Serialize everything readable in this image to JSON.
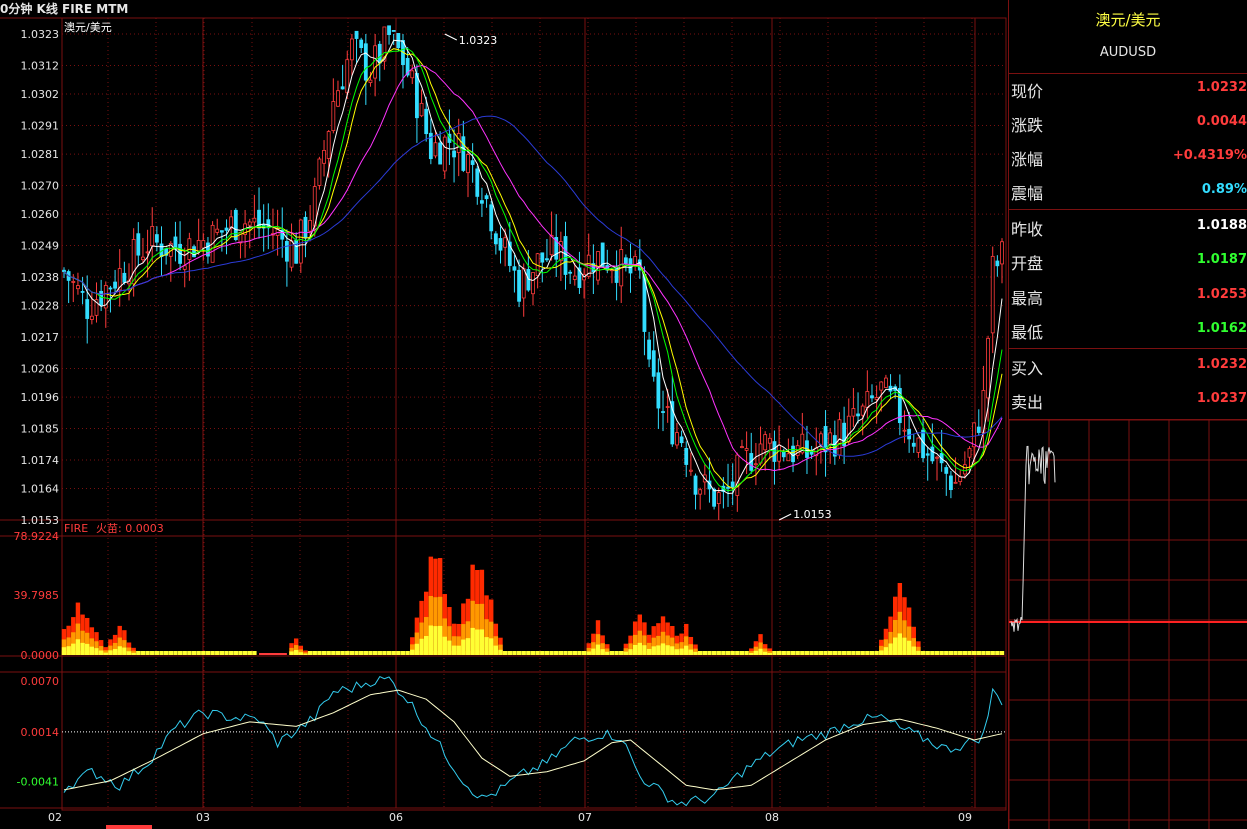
{
  "header": {
    "title": "0分钟 K线 FIRE MTM"
  },
  "colors": {
    "bg": "#000000",
    "grid": "#7a1010",
    "up": "#ff3c3c",
    "down": "#33ddff",
    "ma5": "#ffffff",
    "ma10": "#ffff00",
    "ma20": "#ff33ff",
    "ma30": "#00ff00",
    "ma60": "#2b3bd6",
    "fire_top": "#ff2a00",
    "fire_mid": "#ff9900",
    "fire_base": "#ffff33",
    "mtm": "#33ccee",
    "mtm_ma": "#ffffcc"
  },
  "chart_data": [
    {
      "type": "candlestick",
      "title": "澳元/美元",
      "y_ticks": [
        "1.0323",
        "1.0312",
        "1.0302",
        "1.0291",
        "1.0281",
        "1.0270",
        "1.0260",
        "1.0249",
        "1.0238",
        "1.0228",
        "1.0217",
        "1.0206",
        "1.0196",
        "1.0185",
        "1.0174",
        "1.0164",
        "1.0153"
      ],
      "ylim": [
        1.0153,
        1.0323
      ],
      "x_ticks": [
        "02",
        "03",
        "06",
        "07",
        "08",
        "09"
      ],
      "annotations": {
        "high_label": "1.0323",
        "low_label": "1.0153"
      },
      "close_path": [
        [
          0,
          1.024
        ],
        [
          5,
          1.0228
        ],
        [
          10,
          1.0236
        ],
        [
          18,
          1.025
        ],
        [
          25,
          1.0248
        ],
        [
          32,
          1.0252
        ],
        [
          38,
          1.0258
        ],
        [
          45,
          1.0254
        ],
        [
          50,
          1.0247
        ],
        [
          54,
          1.0265
        ],
        [
          58,
          1.03
        ],
        [
          62,
          1.0318
        ],
        [
          66,
          1.031
        ],
        [
          70,
          1.0322
        ],
        [
          73,
          1.0314
        ],
        [
          76,
          1.03
        ],
        [
          79,
          1.0283
        ],
        [
          83,
          1.0286
        ],
        [
          86,
          1.0282
        ],
        [
          90,
          1.027
        ],
        [
          94,
          1.025
        ],
        [
          98,
          1.0235
        ],
        [
          102,
          1.0243
        ],
        [
          106,
          1.0247
        ],
        [
          110,
          1.024
        ],
        [
          114,
          1.0245
        ],
        [
          118,
          1.0244
        ],
        [
          121,
          1.024
        ],
        [
          124,
          1.0238
        ],
        [
          126,
          1.0203
        ],
        [
          129,
          1.019
        ],
        [
          133,
          1.0182
        ],
        [
          136,
          1.0168
        ],
        [
          139,
          1.0162
        ],
        [
          142,
          1.016
        ],
        [
          146,
          1.0172
        ],
        [
          150,
          1.018
        ],
        [
          155,
          1.0178
        ],
        [
          160,
          1.0176
        ],
        [
          164,
          1.018
        ],
        [
          168,
          1.0184
        ],
        [
          172,
          1.019
        ],
        [
          176,
          1.0198
        ],
        [
          180,
          1.019
        ],
        [
          184,
          1.018
        ],
        [
          188,
          1.0172
        ],
        [
          192,
          1.0166
        ],
        [
          195,
          1.0176
        ],
        [
          198,
          1.0195
        ],
        [
          200,
          1.024
        ],
        [
          202,
          1.0245
        ]
      ],
      "candle_count": 203
    },
    {
      "type": "area",
      "title": "FIRE",
      "label": "火苗: 0.0003",
      "y_ticks": [
        "78.9224",
        "39.7985",
        "0.0000"
      ],
      "ylim": [
        0,
        78.9224
      ],
      "spikes": [
        {
          "at": 3,
          "peak": 36,
          "width": 6
        },
        {
          "at": 12,
          "peak": 22,
          "width": 3
        },
        {
          "at": 50,
          "peak": 12,
          "width": 2
        },
        {
          "at": 80,
          "peak": 79,
          "width": 5
        },
        {
          "at": 89,
          "peak": 74,
          "width": 5
        },
        {
          "at": 115,
          "peak": 24,
          "width": 2
        },
        {
          "at": 124,
          "peak": 30,
          "width": 3
        },
        {
          "at": 129,
          "peak": 34,
          "width": 4
        },
        {
          "at": 134,
          "peak": 22,
          "width": 2
        },
        {
          "at": 150,
          "peak": 14,
          "width": 2
        },
        {
          "at": 180,
          "peak": 54,
          "width": 4
        }
      ],
      "gap": [
        42,
        48
      ]
    },
    {
      "type": "line",
      "title": "MTM",
      "y_ticks": [
        "0.0070",
        "0.0014",
        "-0.0041"
      ],
      "ylim": [
        -0.007,
        0.008
      ],
      "series": [
        {
          "name": "MTM",
          "points": [
            [
              0,
              -0.0048
            ],
            [
              6,
              -0.003
            ],
            [
              12,
              -0.0045
            ],
            [
              18,
              -0.002
            ],
            [
              24,
              0.0018
            ],
            [
              30,
              0.0035
            ],
            [
              36,
              0.003
            ],
            [
              42,
              0.0028
            ],
            [
              46,
              0.0002
            ],
            [
              50,
              0.0015
            ],
            [
              54,
              0.003
            ],
            [
              58,
              0.0058
            ],
            [
              62,
              0.0062
            ],
            [
              66,
              0.007
            ],
            [
              70,
              0.0072
            ],
            [
              74,
              0.005
            ],
            [
              78,
              0.002
            ],
            [
              82,
              -0.001
            ],
            [
              86,
              -0.004
            ],
            [
              90,
              -0.006
            ],
            [
              94,
              -0.005
            ],
            [
              98,
              -0.0035
            ],
            [
              104,
              -0.002
            ],
            [
              110,
              0.0005
            ],
            [
              116,
              0.0012
            ],
            [
              120,
              0.0008
            ],
            [
              124,
              -0.0035
            ],
            [
              128,
              -0.005
            ],
            [
              132,
              -0.0065
            ],
            [
              136,
              -0.0062
            ],
            [
              140,
              -0.0058
            ],
            [
              146,
              -0.003
            ],
            [
              152,
              -0.001
            ],
            [
              158,
              0.0005
            ],
            [
              164,
              0.0012
            ],
            [
              170,
              0.0025
            ],
            [
              176,
              0.003
            ],
            [
              180,
              0.0018
            ],
            [
              186,
              0.0005
            ],
            [
              190,
              -0.0005
            ],
            [
              194,
              0.0
            ],
            [
              198,
              0.001
            ],
            [
              200,
              0.0058
            ],
            [
              202,
              0.0048
            ]
          ]
        },
        {
          "name": "MTMMA",
          "points": [
            [
              0,
              -0.005
            ],
            [
              10,
              -0.004
            ],
            [
              20,
              -0.0015
            ],
            [
              30,
              0.0012
            ],
            [
              40,
              0.0025
            ],
            [
              50,
              0.002
            ],
            [
              58,
              0.0035
            ],
            [
              66,
              0.0055
            ],
            [
              72,
              0.006
            ],
            [
              78,
              0.005
            ],
            [
              84,
              0.0025
            ],
            [
              90,
              -0.0015
            ],
            [
              96,
              -0.0035
            ],
            [
              104,
              -0.003
            ],
            [
              112,
              -0.0018
            ],
            [
              118,
              0.0002
            ],
            [
              122,
              0.0005
            ],
            [
              128,
              -0.002
            ],
            [
              134,
              -0.0045
            ],
            [
              140,
              -0.005
            ],
            [
              148,
              -0.0045
            ],
            [
              156,
              -0.002
            ],
            [
              164,
              0.0005
            ],
            [
              172,
              0.0022
            ],
            [
              180,
              0.0028
            ],
            [
              188,
              0.0018
            ],
            [
              196,
              0.0005
            ],
            [
              202,
              0.0012
            ]
          ]
        }
      ],
      "dotted_level": 0.0014
    }
  ],
  "side_panel": {
    "title": "澳元/美元",
    "code": "AUDUSD",
    "quotes": [
      {
        "label": "现价",
        "value": "1.0232",
        "color": "red"
      },
      {
        "label": "涨跌",
        "value": "0.0044",
        "color": "red"
      },
      {
        "label": "涨幅",
        "value": "+0.4319%",
        "color": "red"
      },
      {
        "label": "震幅",
        "value": "0.89%",
        "color": "cyan"
      },
      {
        "label": "昨收",
        "value": "1.0188",
        "color": "white"
      },
      {
        "label": "开盘",
        "value": "1.0187",
        "color": "green"
      },
      {
        "label": "最高",
        "value": "1.0253",
        "color": "red"
      },
      {
        "label": "最低",
        "value": "1.0162",
        "color": "green"
      },
      {
        "label": "买入",
        "value": "1.0232",
        "color": "red"
      },
      {
        "label": "卖出",
        "value": "1.0237",
        "color": "red"
      }
    ]
  }
}
